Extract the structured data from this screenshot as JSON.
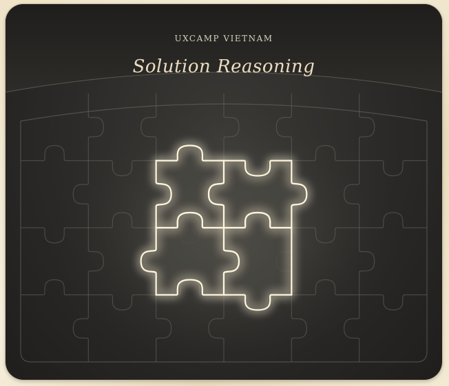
{
  "header": {
    "kicker": "UXCAMP VIETNAM",
    "title": "Solution Reasoning"
  },
  "puzzle": {
    "columns": 6,
    "rows": 4,
    "highlighted_pieces": 4
  },
  "colors": {
    "background": "#2a2927",
    "outer_frame": "#efe4c9",
    "title_text": "#ecdcc0",
    "kicker_text": "#d8cfbb",
    "glow": "#fff6dc"
  }
}
